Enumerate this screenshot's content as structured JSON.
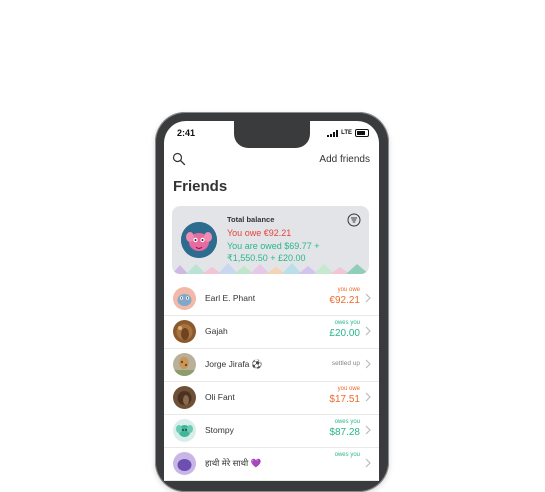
{
  "status_bar": {
    "time": "2:41",
    "network": "LTE"
  },
  "header": {
    "add_friends_label": "Add friends"
  },
  "page": {
    "title": "Friends"
  },
  "balance": {
    "label": "Total balance",
    "owe_text": "You owe €92.21",
    "owed_text": "You are owed $69.77 + ₹1,550.50 + £20.00"
  },
  "friends": [
    {
      "name": "Earl E. Phant",
      "status": "you owe",
      "amount": "€92.21",
      "type": "owe"
    },
    {
      "name": "Gajah",
      "status": "owes you",
      "amount": "£20.00",
      "type": "owed"
    },
    {
      "name": "Jorge Jirafa ⚽",
      "status": "settled up",
      "amount": "",
      "type": "settled"
    },
    {
      "name": "Oli Fant",
      "status": "you owe",
      "amount": "$17.51",
      "type": "owe"
    },
    {
      "name": "Stompy",
      "status": "owes you",
      "amount": "$87.28",
      "type": "owed"
    },
    {
      "name": "हाथी मेरे साथी 💜",
      "status": "owes you",
      "amount": "",
      "type": "owed"
    }
  ],
  "colors": {
    "owe": "#ef6a2b",
    "owed": "#27b78b",
    "owe_balance": "#e4433a"
  },
  "icons": {
    "search": "search-icon",
    "filter": "filter-icon",
    "chevron": "chevron-right-icon"
  }
}
